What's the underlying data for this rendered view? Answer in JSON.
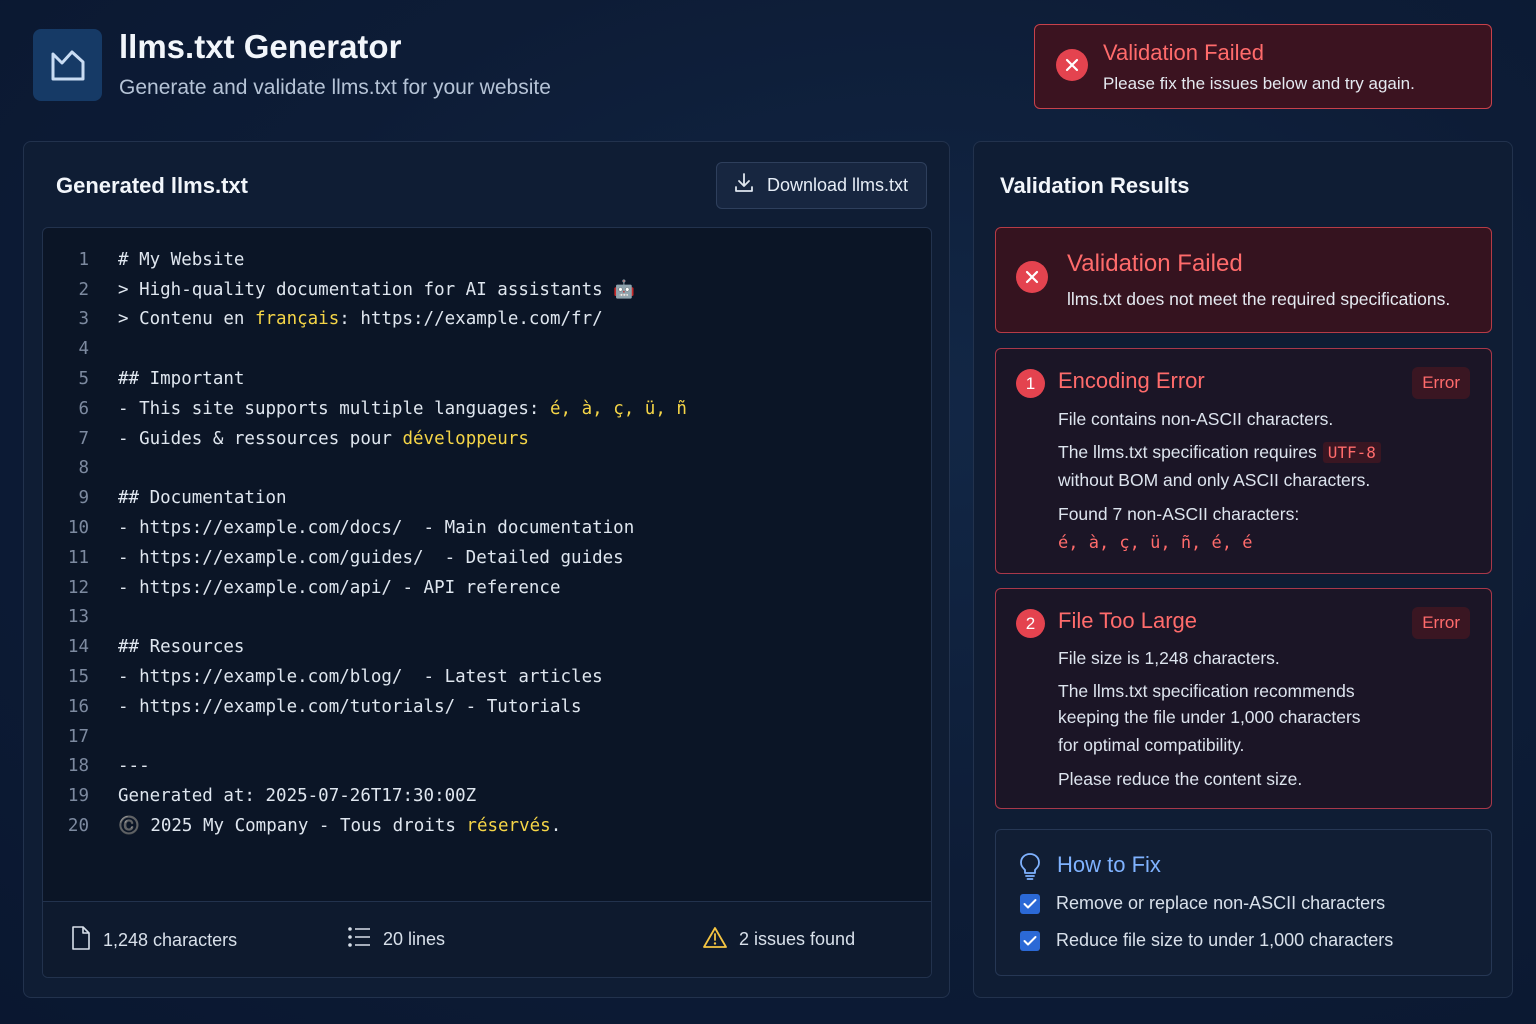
{
  "header": {
    "title": "llms.txt Generator",
    "subtitle": "Generate and validate llms.txt for your website"
  },
  "toast": {
    "title": "Validation Failed",
    "message": "Please fix the issues below and try again."
  },
  "editor": {
    "title": "Generated llms.txt",
    "download_label": "Download llms.txt",
    "lines": [
      {
        "n": "1",
        "text": "# My Website"
      },
      {
        "n": "2",
        "text": "> High-quality documentation for AI assistants 🤖"
      },
      {
        "n": "3",
        "parts": [
          "> Contenu en ",
          "français",
          ": https://example.com/fr/"
        ]
      },
      {
        "n": "4",
        "text": ""
      },
      {
        "n": "5",
        "text": "## Important"
      },
      {
        "n": "6",
        "parts": [
          "- This site supports multiple languages: ",
          "é, à, ç, ü, ñ",
          ""
        ]
      },
      {
        "n": "7",
        "parts": [
          "- Guides & ressources pour ",
          "développeurs",
          ""
        ]
      },
      {
        "n": "8",
        "text": ""
      },
      {
        "n": "9",
        "text": "## Documentation"
      },
      {
        "n": "10",
        "text": "- https://example.com/docs/  - Main documentation"
      },
      {
        "n": "11",
        "text": "- https://example.com/guides/  - Detailed guides"
      },
      {
        "n": "12",
        "text": "- https://example.com/api/ - API reference"
      },
      {
        "n": "13",
        "text": ""
      },
      {
        "n": "14",
        "text": "## Resources"
      },
      {
        "n": "15",
        "text": "- https://example.com/blog/  - Latest articles"
      },
      {
        "n": "16",
        "text": "- https://example.com/tutorials/ - Tutorials"
      },
      {
        "n": "17",
        "text": ""
      },
      {
        "n": "18",
        "text": "---"
      },
      {
        "n": "19",
        "text": "Generated at: 2025-07-26T17:30:00Z"
      },
      {
        "n": "20",
        "parts": [
          "©️ 2025 My Company - Tous droits ",
          "réservés",
          "."
        ]
      }
    ],
    "stats": {
      "characters": "1,248 characters",
      "lines": "20 lines",
      "issues": "2 issues found"
    }
  },
  "validation": {
    "title": "Validation Results",
    "summary": {
      "title": "Validation Failed",
      "message": "llms.txt does not meet the required specifications."
    },
    "issues": [
      {
        "number": "1",
        "title": "Encoding Error",
        "severity": "Error",
        "line1": "File contains non-ASCII characters.",
        "line2_prefix": "The llms.txt specification requires",
        "line2_code": "UTF-8",
        "line3": "without BOM and only ASCII characters.",
        "line4": "Found 7 non-ASCII characters:",
        "chars": "é, à, ç, ü, ñ, é, é"
      },
      {
        "number": "2",
        "title": "File Too Large",
        "severity": "Error",
        "line1": "File size is 1,248 characters.",
        "line2": "The llms.txt specification recommends",
        "line3": "keeping the file under 1,000 characters",
        "line4": "for optimal compatibility.",
        "line5": "Please reduce the content size."
      }
    ],
    "how_to_fix": {
      "title": "How to Fix",
      "items": [
        "Remove or replace non-ASCII characters",
        "Reduce file size to under 1,000 characters"
      ]
    }
  },
  "colors": {
    "error": "#e4434f",
    "error_text": "#ff6b6b",
    "highlight": "#f5d547",
    "accent": "#2b69d6",
    "background": "#0d1c36"
  },
  "icons": {
    "app": "chart-frame-icon",
    "download": "download-icon",
    "error": "x-circle-icon",
    "file": "file-icon",
    "lines": "list-icon",
    "warning": "warning-icon",
    "fix": "lightbulb-icon",
    "check": "checkbox-checked-icon"
  }
}
